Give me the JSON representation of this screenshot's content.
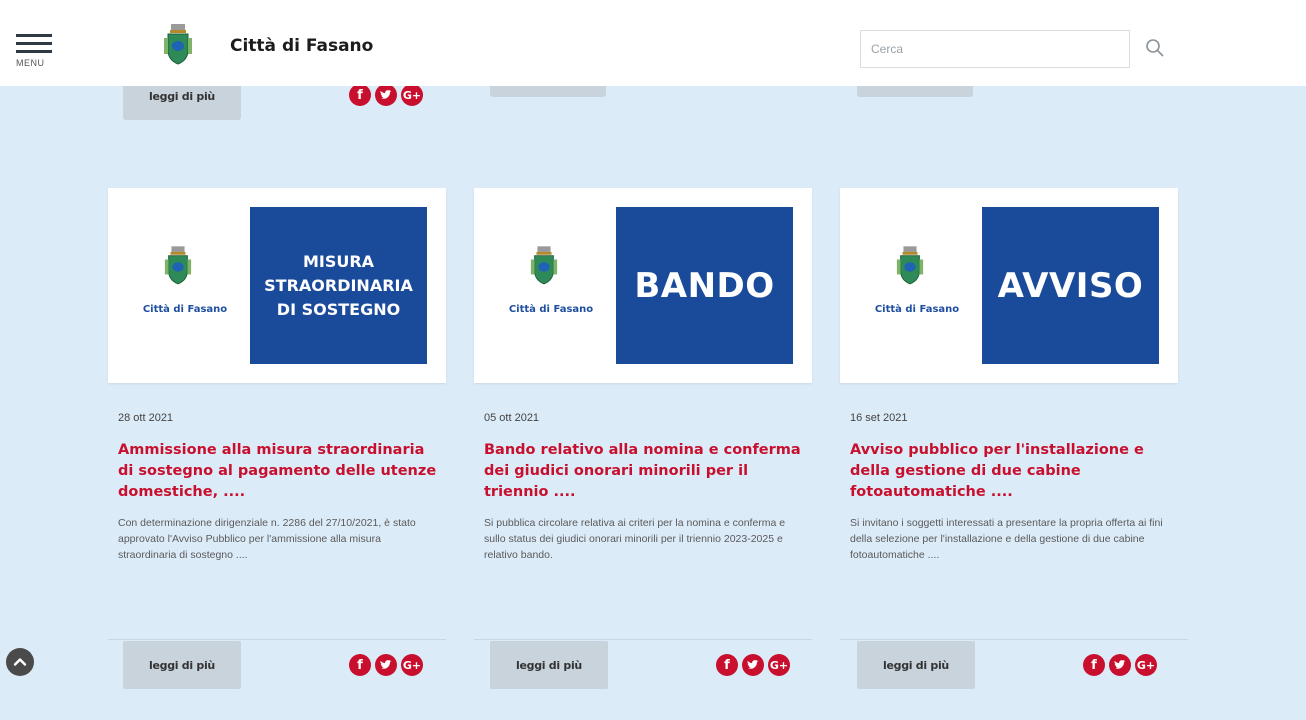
{
  "header": {
    "menu_label": "MENU",
    "site_title": "Città di Fasano",
    "search_placeholder": "Cerca"
  },
  "top_row": {
    "read_more_label": "leggi di più"
  },
  "cards": [
    {
      "image_city_label": "Città di Fasano",
      "image_text_lines": [
        "MISURA",
        "STRAORDINARIA",
        "DI SOSTEGNO"
      ],
      "date": "28 ott 2021",
      "title": "Ammissione alla misura straordinaria di sostegno al pagamento delle utenze domestiche, ....",
      "excerpt": "Con determinazione dirigenziale n. 2286 del 27/10/2021, è stato approvato l'Avviso Pubblico per l'ammissione alla misura straordinaria di sostegno ....",
      "read_more_label": "leggi di più"
    },
    {
      "image_city_label": "Città di Fasano",
      "image_text_lines": [
        "BANDO"
      ],
      "date": "05 ott 2021",
      "title": "Bando relativo alla nomina e conferma dei giudici onorari minorili per il triennio ....",
      "excerpt": "Si pubblica circolare relativa ai criteri per la nomina e conferma e sullo status dei giudici onorari minorili per il triennio 2023-2025 e relativo bando.",
      "read_more_label": "leggi di più"
    },
    {
      "image_city_label": "Città di Fasano",
      "image_text_lines": [
        "AVVISO"
      ],
      "date": "16 set 2021",
      "title": "Avviso pubblico per l'installazione e della gestione di due cabine fotoautomatiche ....",
      "excerpt": "Si invitano i soggetti interessati a presentare la propria offerta ai fini della selezione per l'installazione e della gestione di due cabine fotoautomatiche ....",
      "read_more_label": "leggi di più"
    }
  ],
  "social_icons": [
    "facebook-icon",
    "twitter-icon",
    "google-plus-icon"
  ],
  "colors": {
    "accent_red": "#c8102e",
    "brand_blue": "#1a4b9a",
    "page_bg": "#dcebf8"
  }
}
